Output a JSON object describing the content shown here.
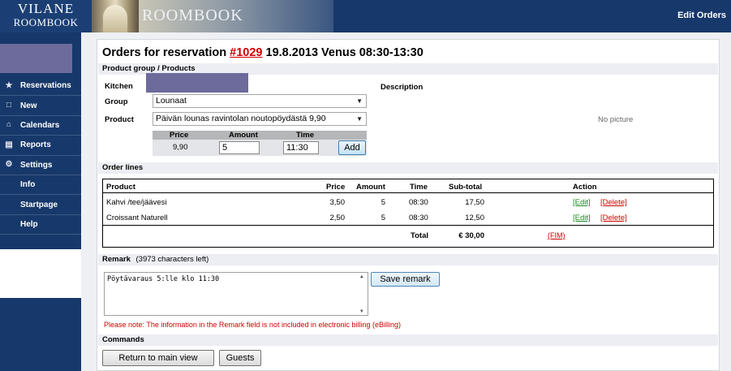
{
  "header": {
    "logo_line1": "VILANE",
    "logo_line2": "ROOMBOOK",
    "banner_title": "ROOMBOOK",
    "page_label": "Edit Orders"
  },
  "sidebar": {
    "items": [
      {
        "label": "Reservations",
        "icon": "reservations-icon"
      },
      {
        "label": "New",
        "icon": "document-icon"
      },
      {
        "label": "Calendars",
        "icon": "home-icon"
      },
      {
        "label": "Reports",
        "icon": "chart-icon"
      },
      {
        "label": "Settings",
        "icon": "gear-icon"
      },
      {
        "label": "Info",
        "icon": ""
      },
      {
        "label": "Startpage",
        "icon": ""
      },
      {
        "label": "Help",
        "icon": ""
      }
    ]
  },
  "main": {
    "title_prefix": "Orders for reservation",
    "reservation_number": "#1029",
    "title_suffix": "19.8.2013 Venus 08:30-13:30",
    "product_section": "Product group / Products",
    "kitchen_label": "Kitchen",
    "group_label": "Group",
    "group_value": "Lounaat",
    "product_label": "Product",
    "product_value": "Päivän lounas ravintolan noutopöydästä  9,90",
    "description_label": "Description",
    "no_picture": "No picture",
    "pat": {
      "price_header": "Price",
      "amount_header": "Amount",
      "time_header": "Time",
      "price_value": "9,90",
      "amount_value": "5",
      "time_value": "11:30",
      "add_label": "Add"
    },
    "order_lines_section": "Order lines",
    "order_table": {
      "headers": {
        "product": "Product",
        "price": "Price",
        "amount": "Amount",
        "time": "Time",
        "subtotal": "Sub-total",
        "action": "Action"
      },
      "rows": [
        {
          "product": "Kahvi /tee/jäävesi",
          "price": "3,50",
          "amount": "5",
          "time": "08:30",
          "subtotal": "17,50",
          "edit": "[Edit]",
          "delete": "[Delete]"
        },
        {
          "product": "Croissant Naturell",
          "price": "2,50",
          "amount": "5",
          "time": "08:30",
          "subtotal": "12,50",
          "edit": "[Edit]",
          "delete": "[Delete]"
        }
      ],
      "total_label": "Total",
      "total_value": "€ 30,00",
      "currency_link": "(FIM)"
    },
    "remark_label": "Remark",
    "remark_counter": "(3973 characters left)",
    "remark_value": "Pöytävaraus 5:lle klo 11:30",
    "save_remark_label": "Save remark",
    "note": "Please note: The information in the Remark field is not included in electronic billing (eBilling)",
    "commands_section": "Commands",
    "return_label": "Return to main view",
    "guests_label": "Guests"
  }
}
